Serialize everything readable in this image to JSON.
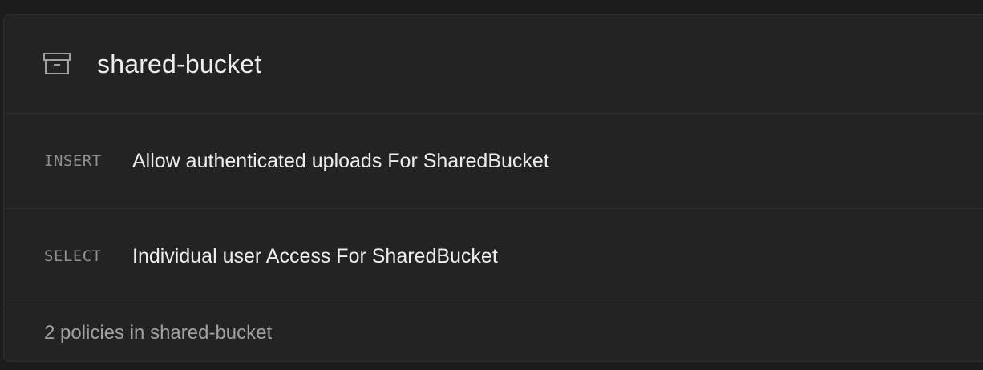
{
  "bucket": {
    "name": "shared-bucket",
    "icon": "archive-icon"
  },
  "policies": [
    {
      "command": "INSERT",
      "name": "Allow authenticated uploads For SharedBucket"
    },
    {
      "command": "SELECT",
      "name": "Individual user Access For SharedBucket"
    }
  ],
  "footer": {
    "summary": "2 policies in shared-bucket"
  },
  "colors": {
    "background": "#1c1c1c",
    "card": "#232323",
    "border": "#2e2e2e",
    "text_primary": "#ededed",
    "text_muted": "#8f8f8f"
  }
}
